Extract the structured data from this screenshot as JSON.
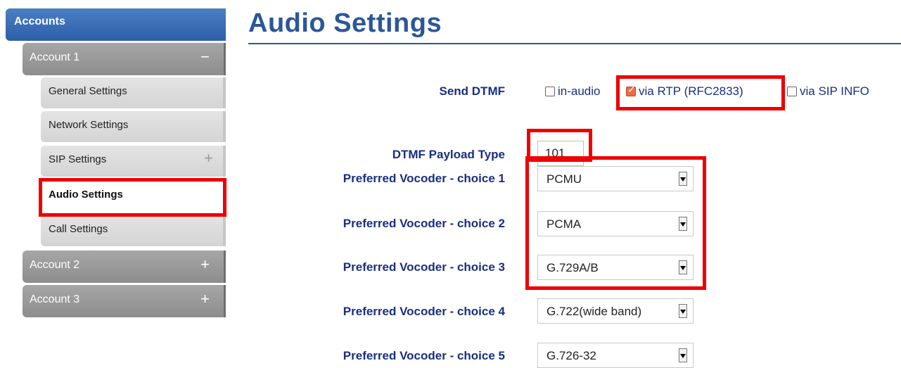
{
  "sidebar": {
    "header": "Accounts",
    "accounts": [
      {
        "label": "Account 1",
        "toggle": "−"
      },
      {
        "label": "Account 2",
        "toggle": "+"
      },
      {
        "label": "Account 3",
        "toggle": "+"
      }
    ],
    "sub_items": [
      {
        "label": "General Settings"
      },
      {
        "label": "Network Settings"
      },
      {
        "label": "SIP Settings",
        "toggle": "+"
      },
      {
        "label": "Audio Settings",
        "active": true
      },
      {
        "label": "Call Settings"
      }
    ]
  },
  "main": {
    "title": "Audio Settings",
    "send_dtmf": {
      "label": "Send DTMF",
      "options": [
        {
          "label": "in-audio",
          "checked": false
        },
        {
          "label": "via RTP (RFC2833)",
          "checked": true
        },
        {
          "label": "via SIP INFO",
          "checked": false
        }
      ]
    },
    "dtmf_payload": {
      "label": "DTMF Payload Type",
      "value": "101"
    },
    "vocoders": [
      {
        "label": "Preferred Vocoder - choice 1",
        "value": "PCMU"
      },
      {
        "label": "Preferred Vocoder - choice 2",
        "value": "PCMA"
      },
      {
        "label": "Preferred Vocoder - choice 3",
        "value": "G.729A/B"
      },
      {
        "label": "Preferred Vocoder - choice 4",
        "value": "G.722(wide band)"
      },
      {
        "label": "Preferred Vocoder - choice 5",
        "value": "G.726-32"
      }
    ]
  },
  "colors": {
    "accent": "#2b5797",
    "label": "#1a2e80",
    "highlight": "#ee0000",
    "checked": "#ee6a4a"
  }
}
